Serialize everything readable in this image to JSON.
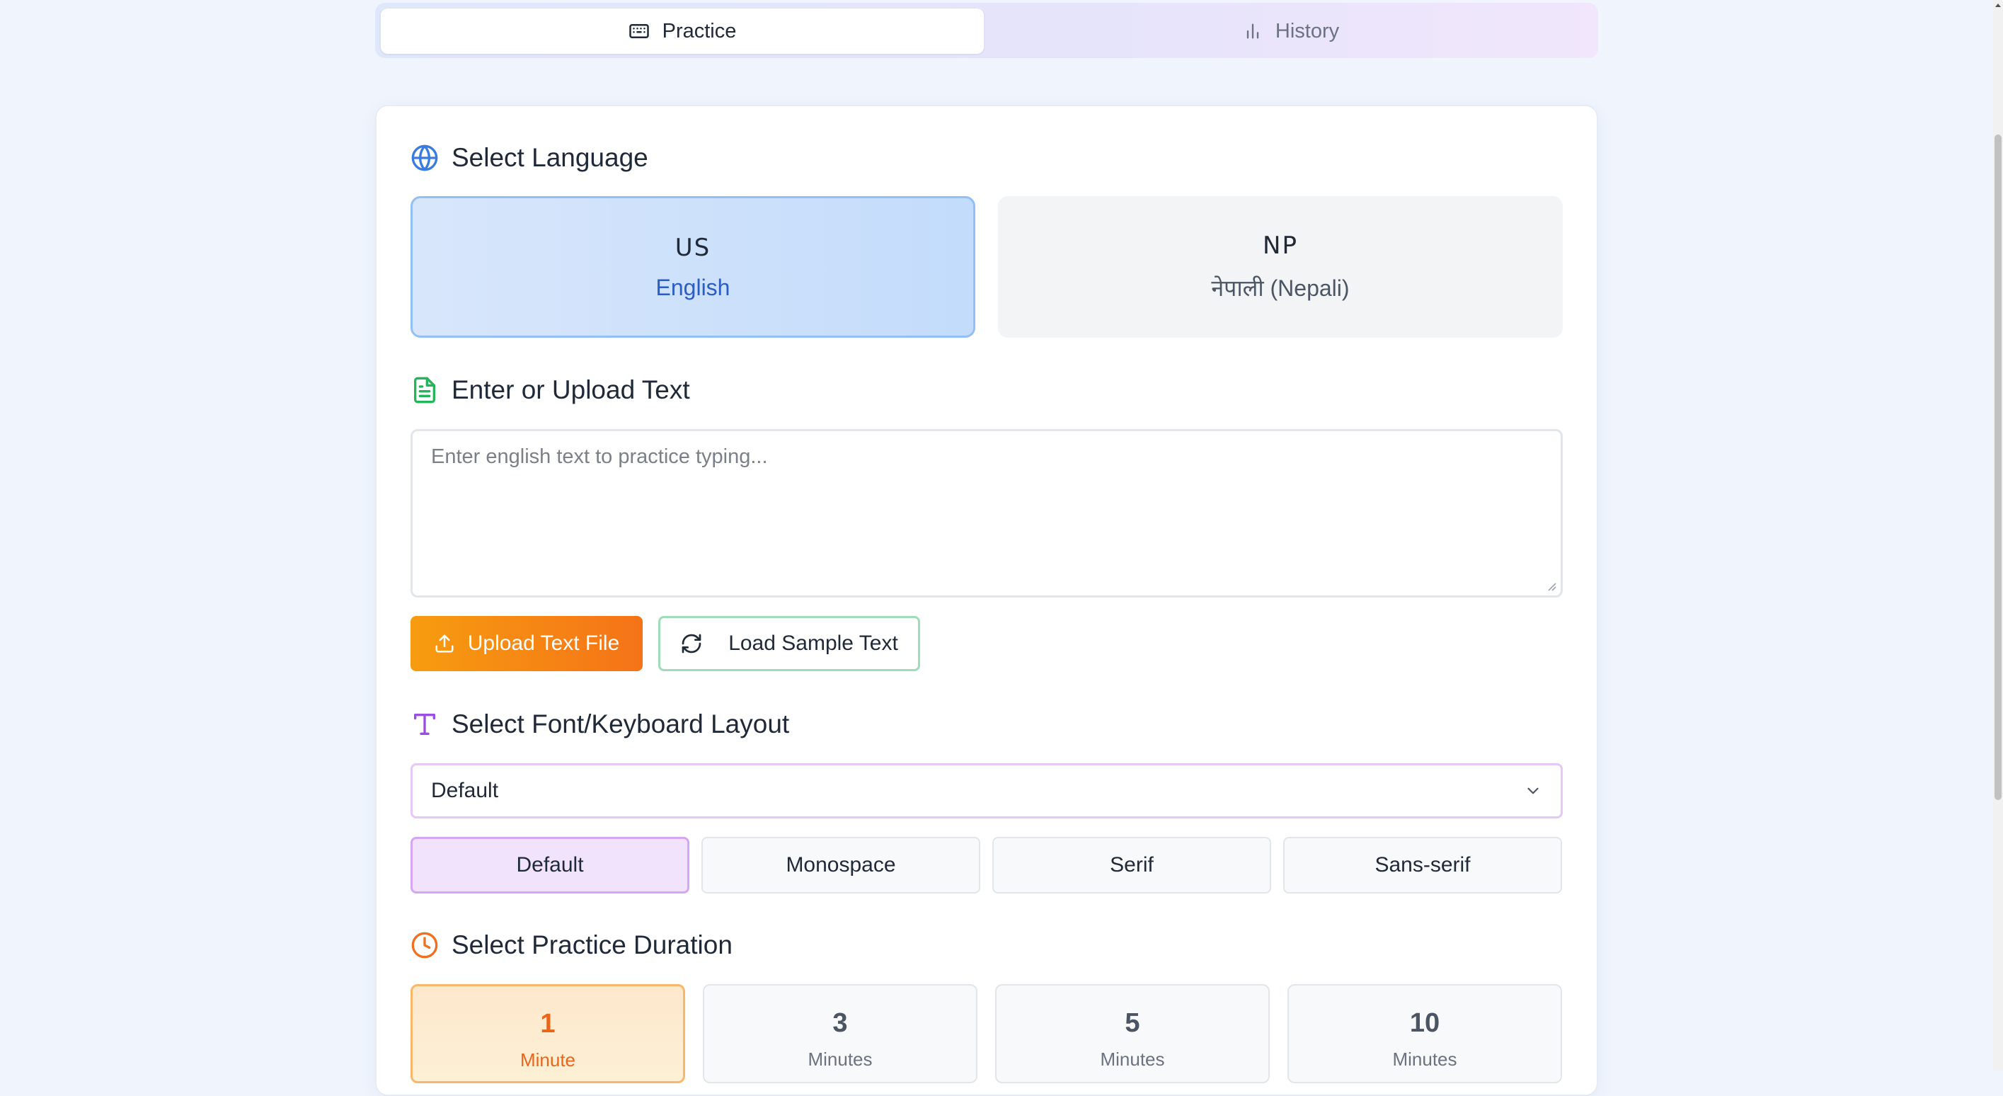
{
  "tabs": [
    {
      "label": "Practice",
      "icon": "keyboard-icon",
      "active": true
    },
    {
      "label": "History",
      "icon": "bar-chart-icon",
      "active": false
    }
  ],
  "language": {
    "title": "Select Language",
    "icon": "globe-icon",
    "options": [
      {
        "code": "US",
        "name": "English",
        "selected": true
      },
      {
        "code": "NP",
        "name": "नेपाली (Nepali)",
        "selected": false
      }
    ]
  },
  "text_input": {
    "title": "Enter or Upload Text",
    "icon": "file-text-icon",
    "placeholder": "Enter english text to practice typing...",
    "value": "",
    "upload_label": "Upload Text File",
    "sample_label": "Load Sample Text"
  },
  "font": {
    "title": "Select Font/Keyboard Layout",
    "icon": "type-icon",
    "selected": "Default",
    "options": [
      {
        "label": "Default",
        "selected": true
      },
      {
        "label": "Monospace",
        "selected": false
      },
      {
        "label": "Serif",
        "selected": false
      },
      {
        "label": "Sans-serif",
        "selected": false
      }
    ]
  },
  "duration": {
    "title": "Select Practice Duration",
    "icon": "clock-icon",
    "options": [
      {
        "value": "1",
        "unit": "Minute",
        "selected": true
      },
      {
        "value": "3",
        "unit": "Minutes",
        "selected": false
      },
      {
        "value": "5",
        "unit": "Minutes",
        "selected": false
      },
      {
        "value": "10",
        "unit": "Minutes",
        "selected": false
      }
    ]
  },
  "colors": {
    "background": "#eff4fd",
    "language_accent": "#2c5cc5",
    "upload_orange": "#f57318",
    "sample_green": "#9fdcb7",
    "font_purple": "#d5a6f3",
    "duration_orange": "#e8651a"
  }
}
